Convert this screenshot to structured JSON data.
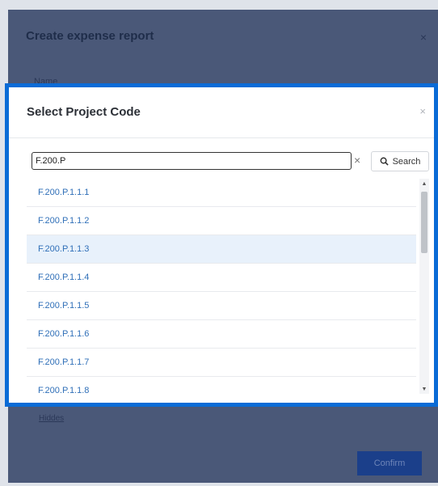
{
  "background_dialog": {
    "title": "Create expense report",
    "close_label": "×",
    "name_label": "Name",
    "link_label": "Hiddes",
    "confirm_label": "Confirm"
  },
  "dialog": {
    "title": "Select Project Code",
    "close_label": "×",
    "search": {
      "value": "F.200.P",
      "clear_label": "×",
      "button_label": "Search"
    },
    "items": [
      {
        "label": "F.200.P.1.1.1"
      },
      {
        "label": "F.200.P.1.1.2"
      },
      {
        "label": "F.200.P.1.1.3",
        "selected": true
      },
      {
        "label": "F.200.P.1.1.4"
      },
      {
        "label": "F.200.P.1.1.5"
      },
      {
        "label": "F.200.P.1.1.6"
      },
      {
        "label": "F.200.P.1.1.7"
      },
      {
        "label": "F.200.P.1.1.8"
      }
    ],
    "scroll_up": "▲",
    "scroll_down": "▼"
  },
  "colors": {
    "accent_frame": "#0a6bd6",
    "link": "#2f6fb8",
    "selected_row": "#e8f1fb"
  }
}
